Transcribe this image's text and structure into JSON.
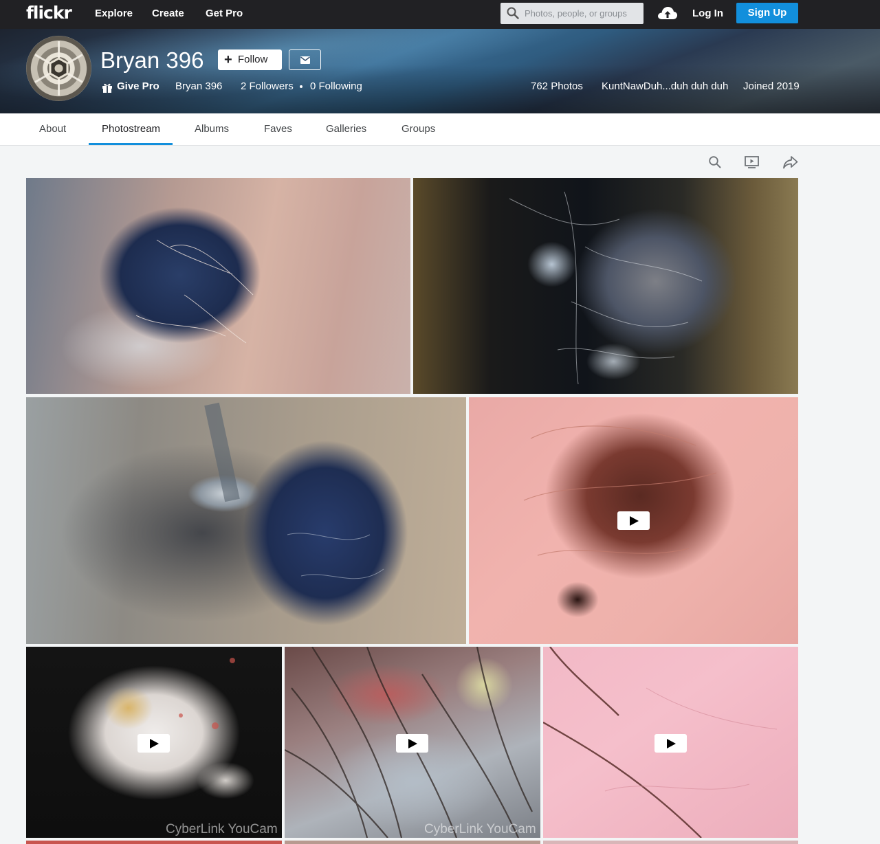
{
  "topnav": {
    "logo": "flickr",
    "links": [
      "Explore",
      "Create",
      "Get Pro"
    ],
    "search_placeholder": "Photos, people, or groups",
    "login": "Log In",
    "signup": "Sign Up"
  },
  "profile": {
    "name": "Bryan 396",
    "follow_label": "Follow",
    "give_pro": "Give Pro",
    "username": "Bryan 396",
    "followers": "2 Followers",
    "following": "0 Following",
    "photos": "762 Photos",
    "location": "KuntNawDuh...duh duh duh",
    "joined": "Joined 2019"
  },
  "subnav": {
    "tabs": [
      "About",
      "Photostream",
      "Albums",
      "Faves",
      "Galleries",
      "Groups"
    ],
    "active": "Photostream"
  },
  "photos": [
    {
      "is_video": false
    },
    {
      "is_video": false
    },
    {
      "is_video": false
    },
    {
      "is_video": true
    },
    {
      "is_video": true,
      "watermark": "CyberLink YouCam"
    },
    {
      "is_video": true,
      "watermark": "CyberLink YouCam"
    },
    {
      "is_video": true
    }
  ],
  "colors": {
    "nav_bg": "#212124",
    "accent": "#128fdc",
    "page_bg": "#f3f5f6"
  }
}
